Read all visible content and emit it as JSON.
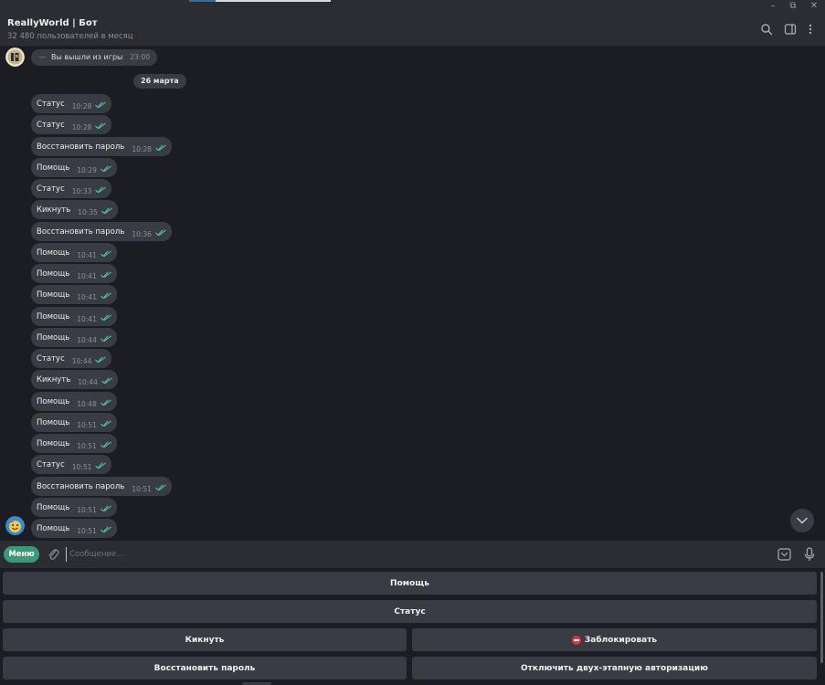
{
  "window": {
    "minimize_glyph": "–",
    "restore_glyph": "⧉",
    "close_glyph": "✕"
  },
  "header": {
    "title": "ReallyWorld | Бот",
    "subtitle": "32 480 пользователей в месяц",
    "icons": [
      "search-icon",
      "sidebar-toggle-icon",
      "more-vertical-icon"
    ]
  },
  "chat": {
    "service_message": {
      "text": "Вы вышли из игры",
      "dash": "—",
      "time": "23:00"
    },
    "date_separator": "26 марта",
    "messages": [
      {
        "text": "Статус",
        "time": "10:28"
      },
      {
        "text": "Статус",
        "time": "10:28"
      },
      {
        "text": "Восстановить пароль",
        "time": "10:28"
      },
      {
        "text": "Помощь",
        "time": "10:29"
      },
      {
        "text": "Статус",
        "time": "10:33"
      },
      {
        "text": "Кикнуть",
        "time": "10:35"
      },
      {
        "text": "Восстановить пароль",
        "time": "10:36"
      },
      {
        "text": "Помощь",
        "time": "10:41"
      },
      {
        "text": "Помощь",
        "time": "10:41"
      },
      {
        "text": "Помощь",
        "time": "10:41"
      },
      {
        "text": "Помощь",
        "time": "10:41"
      },
      {
        "text": "Помощь",
        "time": "10:44"
      },
      {
        "text": "Статус",
        "time": "10:44"
      },
      {
        "text": "Кикнуть",
        "time": "10:44"
      },
      {
        "text": "Помощь",
        "time": "10:48"
      },
      {
        "text": "Помощь",
        "time": "10:51"
      },
      {
        "text": "Помощь",
        "time": "10:51"
      },
      {
        "text": "Статус",
        "time": "10:51"
      },
      {
        "text": "Восстановить пароль",
        "time": "10:51"
      },
      {
        "text": "Помощь",
        "time": "10:51"
      },
      {
        "text": "Помощь",
        "time": "10:51"
      }
    ],
    "read_status": "double-check-icon"
  },
  "composer": {
    "menu_label": "Меню",
    "placeholder": "Сообщение..."
  },
  "keyboard": {
    "row1": "Помощь",
    "row2": "Статус",
    "row3_left": "Кикнуть",
    "row3_right": "Заблокировать",
    "row4_left": "Восстановить пароль",
    "row4_right": "Отключить двух-этапную авторизацию"
  },
  "colors": {
    "accent": "#3a9a77",
    "check": "#4cc39a",
    "bubble": "#3a3c43",
    "background": "#1c1d22",
    "panel": "#2b2d33"
  }
}
